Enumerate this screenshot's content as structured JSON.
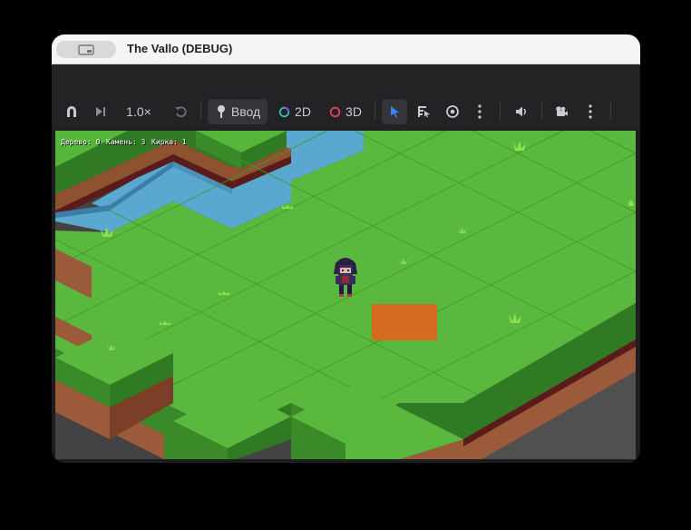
{
  "window": {
    "title": "The Vallo (DEBUG)"
  },
  "toolbar": {
    "speed_label": "1.0×",
    "input_label": "Ввод",
    "mode_2d_label": "2D",
    "mode_3d_label": "3D"
  },
  "hud": {
    "wood": "Дерево: 0",
    "stone": "Камень: 3",
    "pickaxe": "Кирка: 1"
  },
  "colors": {
    "accent_blue": "#3b82f6",
    "grass_top": "#59b83d",
    "grass_side": "#3a8a2a",
    "dirt_side": "#9b5a3a",
    "water": "#5aa8d0",
    "highlight_tile": "#d66a20"
  }
}
